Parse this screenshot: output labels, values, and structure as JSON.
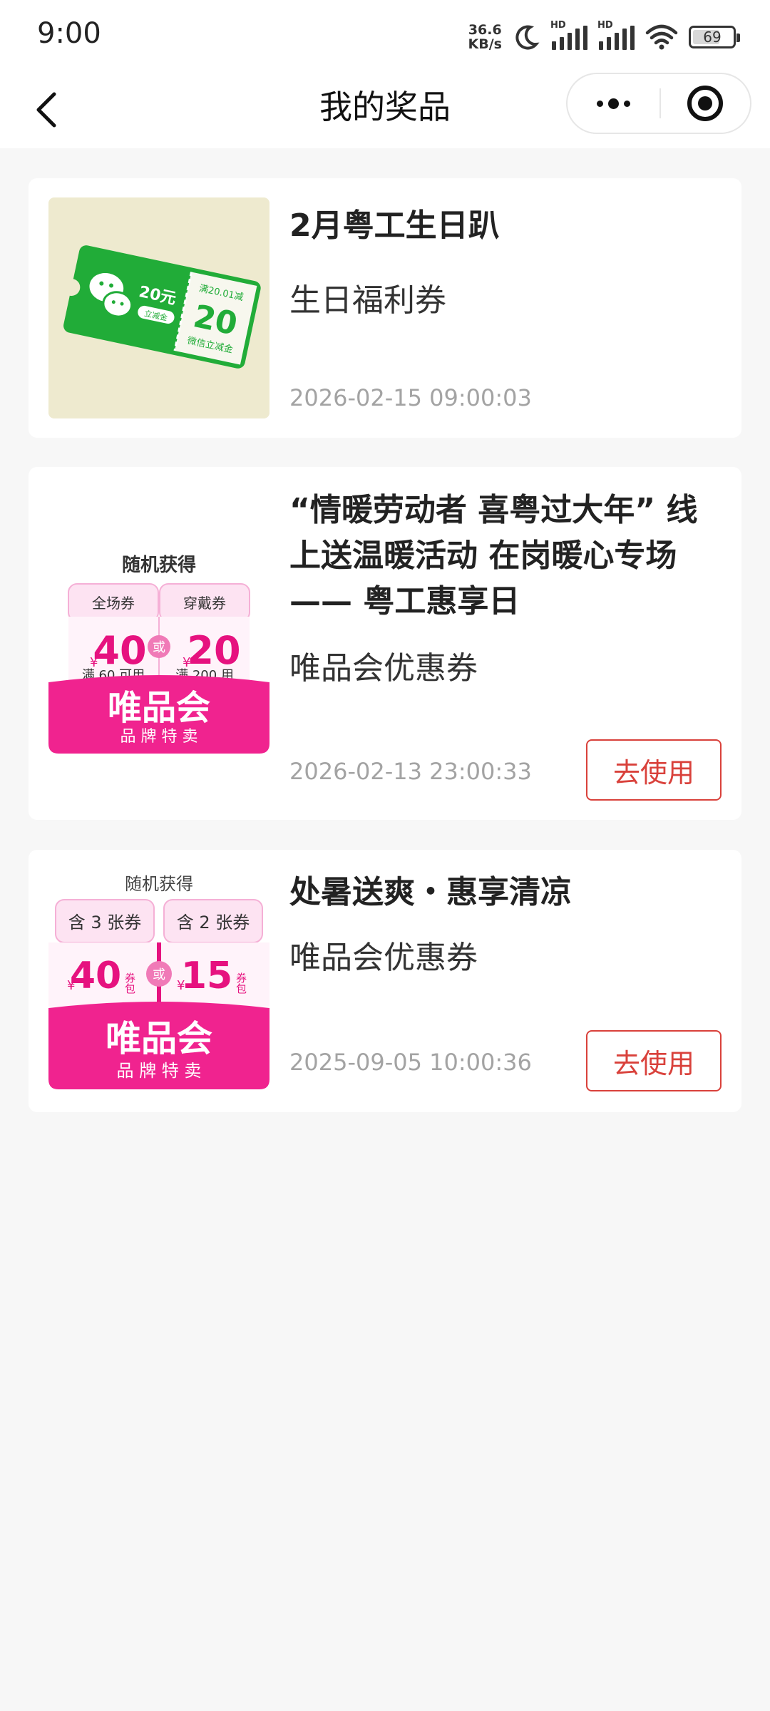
{
  "status_bar": {
    "time": "9:00",
    "net_speed_value": "36.6",
    "net_speed_unit": "KB/s",
    "signal_1_tag": "HD",
    "signal_2_tag": "HD",
    "battery": "69",
    "battery_level": 0.69
  },
  "nav": {
    "title": "我的奖品"
  },
  "prizes": [
    {
      "title": "2月粤工生日趴",
      "subtitle": "生日福利券",
      "time": "2026-02-15 09:00:03",
      "image": {
        "amount_left": "20元",
        "tag": "立减金",
        "condition": "满20.01减",
        "amount_right": "20",
        "caption": "微信立减金"
      }
    },
    {
      "title": "“情暖劳动者 喜粤过大年” 线上送温暖活动 在岗暖心专场 —— 粤工惠享日",
      "subtitle": "唯品会优惠券",
      "time": "2026-02-13 23:00:33",
      "button": "去使用",
      "image": {
        "header": "随机获得",
        "tab_left": "全场券",
        "tab_right": "穿戴券",
        "currency": "¥",
        "value_left": "40",
        "value_right": "20",
        "or": "或",
        "cond_left": "满 60 可用",
        "cond_right": "满 200 用",
        "brand": "唯品会",
        "slogan": "品 牌 特 卖"
      }
    },
    {
      "title": "处暑送爽・惠享清凉",
      "subtitle": "唯品会优惠券",
      "time": "2025-09-05 10:00:36",
      "button": "去使用",
      "image": {
        "header": "随机获得",
        "tab_left": "含 3 张券",
        "tab_right": "含 2 张券",
        "currency": "¥",
        "value_left": "40",
        "value_right": "15",
        "pack": "券包",
        "or": "或",
        "brand": "唯品会",
        "slogan": "品 牌 特 卖"
      }
    }
  ]
}
